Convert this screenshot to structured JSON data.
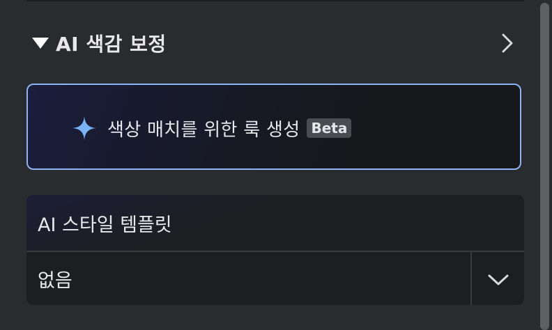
{
  "section": {
    "title": "AI 색감 보정"
  },
  "ai_look": {
    "label": "색상 매치를 위한 룩 생성",
    "badge": "Beta"
  },
  "style_template": {
    "title": "AI 스타일 템플릿",
    "selected_value": "없음"
  },
  "colors": {
    "card_border": "#8fb4f3",
    "sparkle": "#7ab4f5"
  }
}
